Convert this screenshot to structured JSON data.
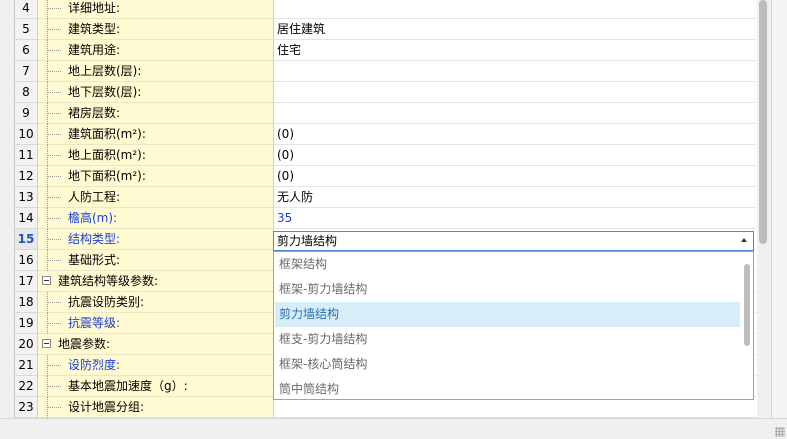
{
  "rows": [
    {
      "num": "4",
      "label": "详细地址:",
      "value": "",
      "blue": false,
      "group": false
    },
    {
      "num": "5",
      "label": "建筑类型:",
      "value": "居住建筑",
      "blue": false,
      "group": false
    },
    {
      "num": "6",
      "label": "建筑用途:",
      "value": "住宅",
      "blue": false,
      "group": false
    },
    {
      "num": "7",
      "label": "地上层数(层):",
      "value": "",
      "blue": false,
      "group": false
    },
    {
      "num": "8",
      "label": "地下层数(层):",
      "value": "",
      "blue": false,
      "group": false
    },
    {
      "num": "9",
      "label": "裙房层数:",
      "value": "",
      "blue": false,
      "group": false
    },
    {
      "num": "10",
      "label": "建筑面积(m²):",
      "value": "(0)",
      "blue": false,
      "group": false
    },
    {
      "num": "11",
      "label": "地上面积(m²):",
      "value": "(0)",
      "blue": false,
      "group": false
    },
    {
      "num": "12",
      "label": "地下面积(m²):",
      "value": "(0)",
      "blue": false,
      "group": false
    },
    {
      "num": "13",
      "label": "人防工程:",
      "value": "无人防",
      "blue": false,
      "group": false
    },
    {
      "num": "14",
      "label": "檐高(m):",
      "value": "35",
      "blue": true,
      "group": false
    },
    {
      "num": "15",
      "label": "结构类型:",
      "value": "",
      "blue": true,
      "group": false,
      "active": true
    },
    {
      "num": "16",
      "label": "基础形式:",
      "value": "",
      "blue": false,
      "group": false
    },
    {
      "num": "17",
      "label": "建筑结构等级参数:",
      "value": "",
      "blue": false,
      "group": true
    },
    {
      "num": "18",
      "label": "抗震设防类别:",
      "value": "",
      "blue": false,
      "group": false
    },
    {
      "num": "19",
      "label": "抗震等级:",
      "value": "",
      "blue": true,
      "group": false
    },
    {
      "num": "20",
      "label": "地震参数:",
      "value": "",
      "blue": false,
      "group": true
    },
    {
      "num": "21",
      "label": "设防烈度:",
      "value": "",
      "blue": true,
      "group": false
    },
    {
      "num": "22",
      "label": "基本地震加速度（g）:",
      "value": "",
      "blue": false,
      "group": false
    },
    {
      "num": "23",
      "label": "设计地震分组:",
      "value": "",
      "blue": false,
      "group": false
    }
  ],
  "combo": {
    "value": "剪力墙结构"
  },
  "dropdown": {
    "options": [
      "框架结构",
      "框架-剪力墙结构",
      "剪力墙结构",
      "框支-剪力墙结构",
      "框架-核心筒结构",
      "筒中筒结构"
    ],
    "selected_index": 2
  },
  "icons": {
    "expander": "collapse-minus-icon",
    "combo_arrow": "caret-up-icon",
    "grip": "resize-grip-icon"
  },
  "colors": {
    "key_bg": "#fffad1",
    "selected_bg": "#d7eefa",
    "blue_label": "#1a3fd6",
    "focus_border": "#4a8ad4"
  }
}
